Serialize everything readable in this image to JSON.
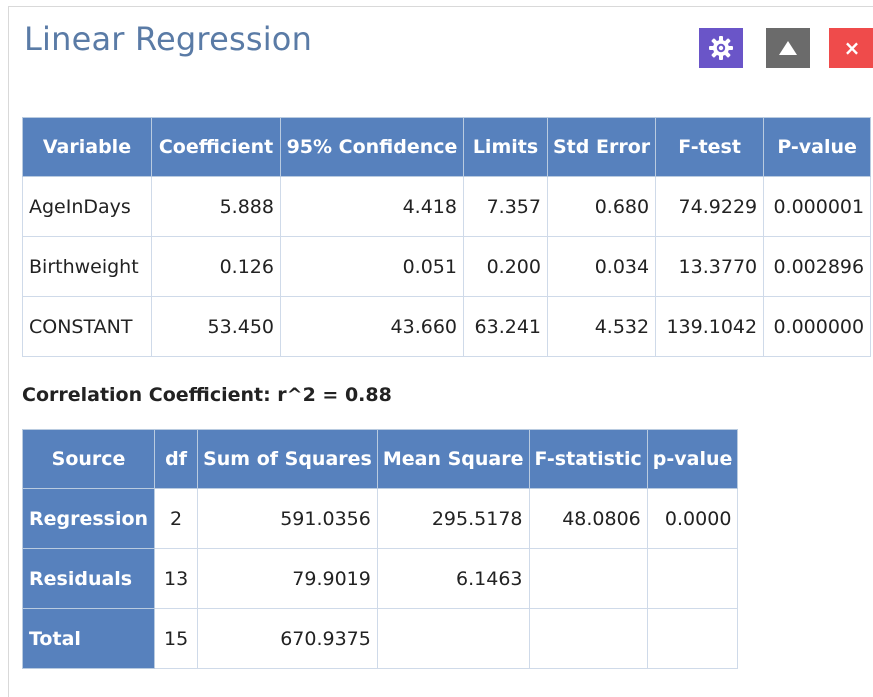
{
  "window": {
    "title": "Linear Regression"
  },
  "toolbar": {
    "settings_icon": "gear-icon",
    "collapse_icon": "triangle-up-icon",
    "close_label": "×"
  },
  "coefficients": {
    "headers": [
      "Variable",
      "Coefficient",
      "95% Confidence",
      "Limits",
      "Std Error",
      "F-test",
      "P-value"
    ],
    "rows": [
      [
        "AgeInDays",
        "5.888",
        "4.418",
        "7.357",
        "0.680",
        "74.9229",
        "0.000001"
      ],
      [
        "Birthweight",
        "0.126",
        "0.051",
        "0.200",
        "0.034",
        "13.3770",
        "0.002896"
      ],
      [
        "CONSTANT",
        "53.450",
        "43.660",
        "63.241",
        "4.532",
        "139.1042",
        "0.000000"
      ]
    ]
  },
  "correlation": {
    "text": "Correlation Coefficient: r^2 = 0.88"
  },
  "anova": {
    "headers": [
      "Source",
      "df",
      "Sum of Squares",
      "Mean Square",
      "F-statistic",
      "p-value"
    ],
    "rows": [
      [
        "Regression",
        "2",
        "591.0356",
        "295.5178",
        "48.0806",
        "0.0000"
      ],
      [
        "Residuals",
        "13",
        "79.9019",
        "6.1463",
        "",
        ""
      ],
      [
        "Total",
        "15",
        "670.9375",
        "",
        "",
        ""
      ]
    ]
  },
  "colors": {
    "header_bg": "#5781bd",
    "title": "#5a7ba6",
    "settings_button": "#6a55c8",
    "collapse_button": "#6b6b6b",
    "close_button": "#ef4b4b"
  }
}
